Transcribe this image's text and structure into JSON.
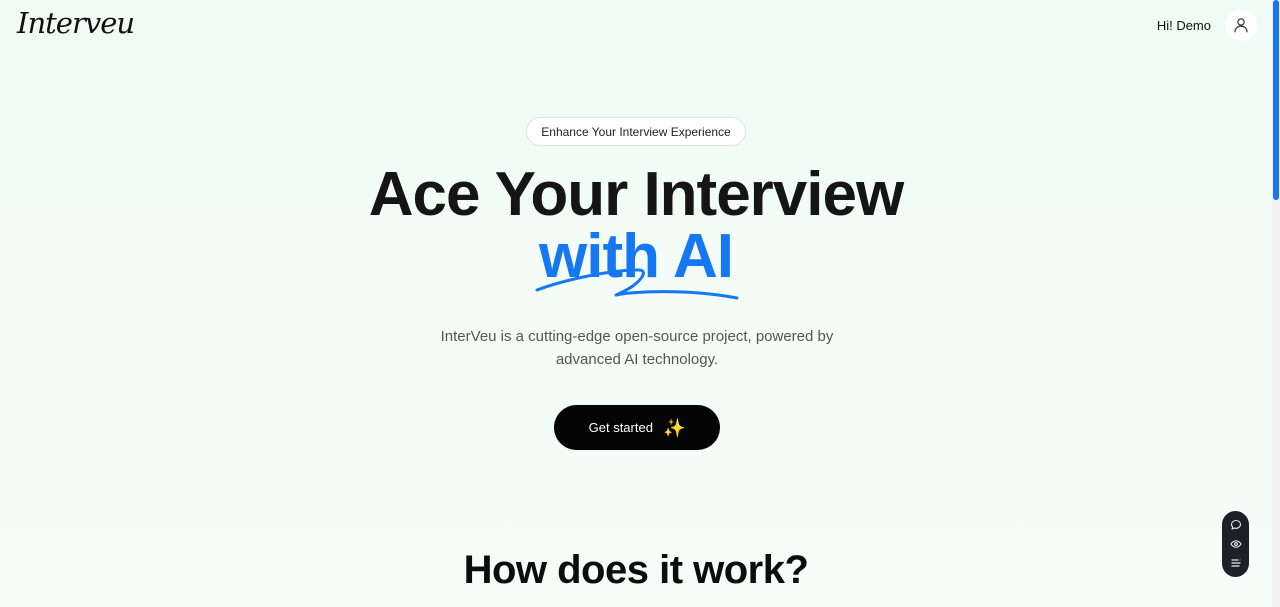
{
  "header": {
    "logo_text": "Interveu",
    "greeting": "Hi! Demo",
    "avatar_icon": "user-icon"
  },
  "hero": {
    "badge": "Enhance Your Interview Experience",
    "title_line1": "Ace Your Interview",
    "title_line2": "with AI",
    "subtitle_line1": "InterVeu is a cutting-edge open-source project, powered by",
    "subtitle_line2": "advanced AI technology.",
    "cta_label": "Get started",
    "cta_icon": "sparkles-icon"
  },
  "section": {
    "title": "How does it work?"
  },
  "float_panel": {
    "icons": [
      "chat-icon",
      "eye-icon",
      "list-icon"
    ]
  },
  "colors": {
    "accent": "#1677f2",
    "background": "#f0fbf5",
    "button": "#050505",
    "panel": "#1b2127"
  }
}
